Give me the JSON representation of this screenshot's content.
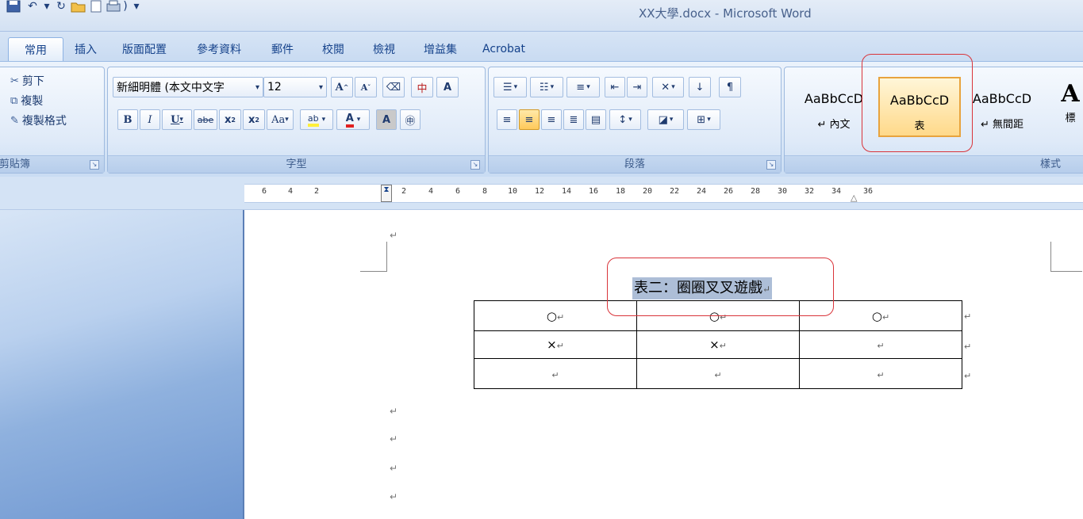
{
  "window": {
    "title": "XX大學.docx - Microsoft Word"
  },
  "qat": {
    "icons": [
      "save-icon",
      "undo-icon",
      "redo-icon",
      "open-icon",
      "new-icon",
      "print-icon",
      "customize-icon"
    ]
  },
  "tabs": [
    {
      "label": "常用",
      "active": true
    },
    {
      "label": "插入"
    },
    {
      "label": "版面配置"
    },
    {
      "label": "參考資料"
    },
    {
      "label": "郵件"
    },
    {
      "label": "校閱"
    },
    {
      "label": "檢視"
    },
    {
      "label": "增益集"
    },
    {
      "label": "Acrobat"
    }
  ],
  "clipboard": {
    "cut": "剪下",
    "copy": "複製",
    "format_painter": "複製格式",
    "label": "剪貼簿"
  },
  "font": {
    "name": "新細明體 (本文中文字",
    "size": "12",
    "label": "字型"
  },
  "paragraph": {
    "label": "段落"
  },
  "styles": {
    "label": "樣式",
    "items": [
      {
        "sample": "AaBbCcD",
        "name": "↵ 內文"
      },
      {
        "sample": "AaBbCcD",
        "name": "表",
        "selected": true
      },
      {
        "sample": "AaBbCcD",
        "name": "↵ 無間距"
      },
      {
        "sample": "A",
        "name": "標"
      }
    ]
  },
  "ruler": {
    "ticks": [
      "6",
      "4",
      "2",
      "2",
      "4",
      "6",
      "8",
      "10",
      "12",
      "14",
      "16",
      "18",
      "20",
      "22",
      "24",
      "26",
      "28",
      "30",
      "32",
      "34",
      "36"
    ]
  },
  "document": {
    "title": "表二：圈圈叉叉遊戲",
    "table": [
      [
        "○",
        "○",
        "○"
      ],
      [
        "×",
        "×",
        ""
      ],
      [
        "",
        "",
        ""
      ]
    ]
  },
  "colors": {
    "highlight": "#d9343a",
    "selection": "#adbed7",
    "ribbon": "#dbe8f7"
  }
}
